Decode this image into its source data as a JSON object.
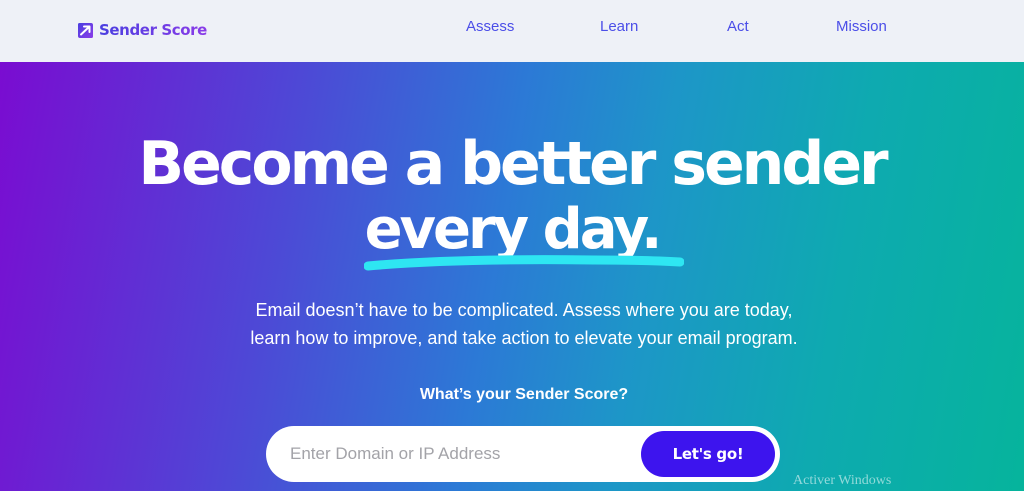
{
  "brand": {
    "name": "Sender Score",
    "logo_icon": "paper-plane-icon"
  },
  "nav": {
    "items": [
      {
        "label": "Assess"
      },
      {
        "label": "Learn"
      },
      {
        "label": "Act"
      },
      {
        "label": "Mission"
      }
    ]
  },
  "hero": {
    "headline_line1": "Become a better sender",
    "headline_line2": "every day.",
    "subtext_line1": "Email doesn’t have to be complicated. Assess where you are today,",
    "subtext_line2": "learn how to improve, and take action to elevate your email program.",
    "question": "What’s your Sender Score?",
    "search_placeholder": "Enter Domain or IP Address",
    "cta_label": "Let's go!"
  },
  "watermark": "Activer Windows",
  "colors": {
    "nav_background": "#eef1f7",
    "nav_link": "#4b4ee8",
    "cta_button": "#3d14ee",
    "underline_accent": "#2ee6f2",
    "hero_gradient_start": "#7a0cd1",
    "hero_gradient_end": "#06b49c"
  }
}
